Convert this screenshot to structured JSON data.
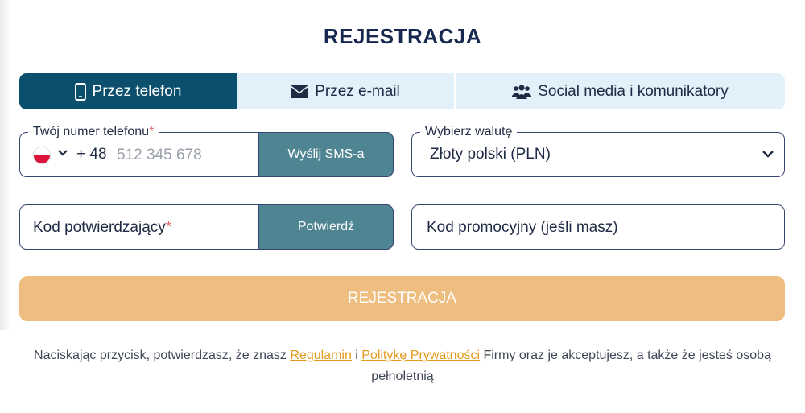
{
  "page": {
    "title": "REJESTRACJA"
  },
  "tabs": [
    {
      "label": "Przez telefon",
      "icon": "phone-icon",
      "active": true
    },
    {
      "label": "Przez e-mail",
      "icon": "envelope-icon",
      "active": false
    },
    {
      "label": "Social media i komunikatory",
      "icon": "users-icon",
      "active": false
    }
  ],
  "phone": {
    "label": "Twój numer telefonu",
    "required_mark": "*",
    "country_icon": "poland-flag-icon",
    "prefix": "+ 48",
    "placeholder": "512 345 678",
    "button_label": "Wyślij SMS-a"
  },
  "currency": {
    "label": "Wybierz walutę",
    "selected": "Złoty polski (PLN)"
  },
  "code": {
    "label": "Kod potwierdzający",
    "required_mark": "*",
    "button_label": "Potwierdź"
  },
  "promo": {
    "placeholder": "Kod promocyjny (jeśli masz)"
  },
  "register": {
    "label": "REJESTRACJA"
  },
  "legal": {
    "before": "Naciskając przycisk, potwierdzasz, że znasz ",
    "link_terms": "Regulamin",
    "middle": " i ",
    "link_privacy": "Politykę Prywatności",
    "after": " Firmy oraz je akceptujesz, a także że jesteś osobą pełnoletnią"
  },
  "colors": {
    "primary": "#0b4f6c",
    "tab_bg": "#e1f0f9",
    "button": "#4f8593",
    "register": "#edbe7f",
    "link": "#e39a1c",
    "title": "#16284f"
  }
}
